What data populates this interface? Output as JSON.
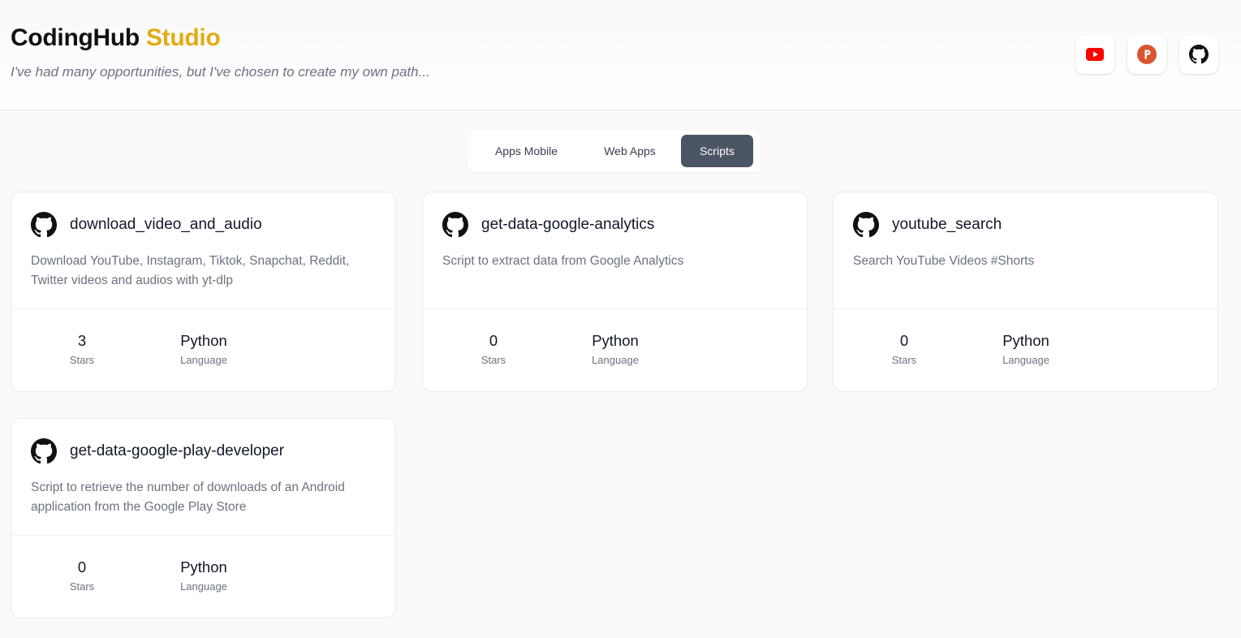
{
  "header": {
    "brand_part1": "CodingHub",
    "brand_part2": "Studio",
    "tagline": "I've had many opportunities, but I've chosen to create my own path..."
  },
  "social": [
    {
      "icon": "youtube-icon",
      "color": "#ff0000"
    },
    {
      "icon": "producthunt-icon",
      "color": "#da552f"
    },
    {
      "icon": "github-icon",
      "color": "#111111"
    }
  ],
  "tabs": [
    {
      "label": "Apps Mobile",
      "active": false
    },
    {
      "label": "Web Apps",
      "active": false
    },
    {
      "label": "Scripts",
      "active": true
    }
  ],
  "stat_labels": {
    "stars": "Stars",
    "language": "Language"
  },
  "repos": [
    {
      "name": "download_video_and_audio",
      "description": "Download YouTube, Instagram, Tiktok, Snapchat, Reddit, Twitter videos and audios with yt-dlp",
      "stars": "3",
      "language": "Python"
    },
    {
      "name": "get-data-google-analytics",
      "description": "Script to extract data from Google Analytics",
      "stars": "0",
      "language": "Python"
    },
    {
      "name": "youtube_search",
      "description": "Search YouTube Videos #Shorts",
      "stars": "0",
      "language": "Python"
    },
    {
      "name": "get-data-google-play-developer",
      "description": "Script to retrieve the number of downloads of an Android application from the Google Play Store",
      "stars": "0",
      "language": "Python"
    }
  ],
  "colors": {
    "accent": "#e3ab14",
    "active_tab": "#4b5563",
    "muted_text": "#6b7280"
  }
}
